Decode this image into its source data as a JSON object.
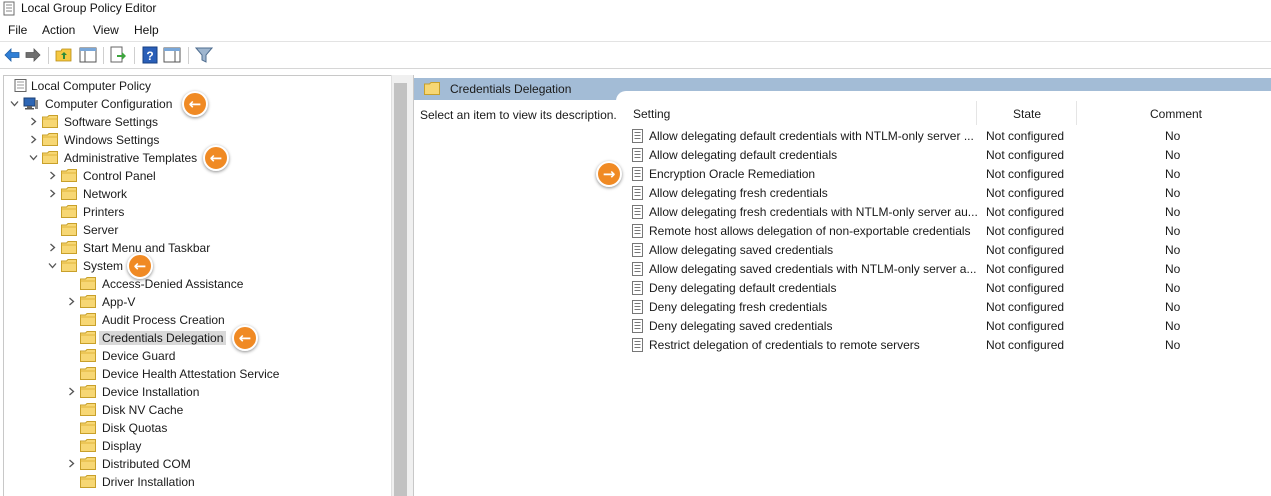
{
  "window": {
    "title": "Local Group Policy Editor"
  },
  "menu": {
    "file": "File",
    "action": "Action",
    "view": "View",
    "help": "Help"
  },
  "toolbar": {
    "icons": [
      "back-arrow-icon",
      "forward-arrow-icon",
      "up-folder-icon",
      "show-hide-tree-icon",
      "export-list-icon",
      "help-icon",
      "properties-pane-icon",
      "filter-icon"
    ]
  },
  "tree": {
    "root": "Local Computer Policy",
    "computer_configuration": "Computer Configuration",
    "software_settings": "Software Settings",
    "windows_settings": "Windows Settings",
    "administrative_templates": "Administrative Templates",
    "control_panel": "Control Panel",
    "network": "Network",
    "printers": "Printers",
    "server": "Server",
    "start_menu": "Start Menu and Taskbar",
    "system": "System",
    "access_denied": "Access-Denied Assistance",
    "app_v": "App-V",
    "audit_process": "Audit Process Creation",
    "credentials_delegation": "Credentials Delegation",
    "device_guard": "Device Guard",
    "device_health": "Device Health Attestation Service",
    "device_installation": "Device Installation",
    "disk_nv_cache": "Disk NV Cache",
    "disk_quotas": "Disk Quotas",
    "display": "Display",
    "distributed_com": "Distributed COM",
    "driver_installation": "Driver Installation"
  },
  "right_pane": {
    "header_title": "Credentials Delegation",
    "description": "Select an item to view its description.",
    "columns": {
      "setting": "Setting",
      "state": "State",
      "comment": "Comment"
    },
    "rows": [
      {
        "setting": "Allow delegating default credentials with NTLM-only server ...",
        "state": "Not configured",
        "comment": "No"
      },
      {
        "setting": "Allow delegating default credentials",
        "state": "Not configured",
        "comment": "No"
      },
      {
        "setting": "Encryption Oracle Remediation",
        "state": "Not configured",
        "comment": "No"
      },
      {
        "setting": "Allow delegating fresh credentials",
        "state": "Not configured",
        "comment": "No"
      },
      {
        "setting": "Allow delegating fresh credentials with NTLM-only server au...",
        "state": "Not configured",
        "comment": "No"
      },
      {
        "setting": "Remote host allows delegation of non-exportable credentials",
        "state": "Not configured",
        "comment": "No"
      },
      {
        "setting": "Allow delegating saved credentials",
        "state": "Not configured",
        "comment": "No"
      },
      {
        "setting": "Allow delegating saved credentials with NTLM-only server a...",
        "state": "Not configured",
        "comment": "No"
      },
      {
        "setting": "Deny delegating default credentials",
        "state": "Not configured",
        "comment": "No"
      },
      {
        "setting": "Deny delegating fresh credentials",
        "state": "Not configured",
        "comment": "No"
      },
      {
        "setting": "Deny delegating saved credentials",
        "state": "Not configured",
        "comment": "No"
      },
      {
        "setting": "Restrict delegation of credentials to remote servers",
        "state": "Not configured",
        "comment": "No"
      }
    ]
  },
  "annotations": {
    "left_arrow": "←",
    "right_arrow": "→"
  },
  "colors": {
    "header_band": "#a3bcd6",
    "badge": "#f08a24",
    "selection": "#d9d9d9"
  }
}
